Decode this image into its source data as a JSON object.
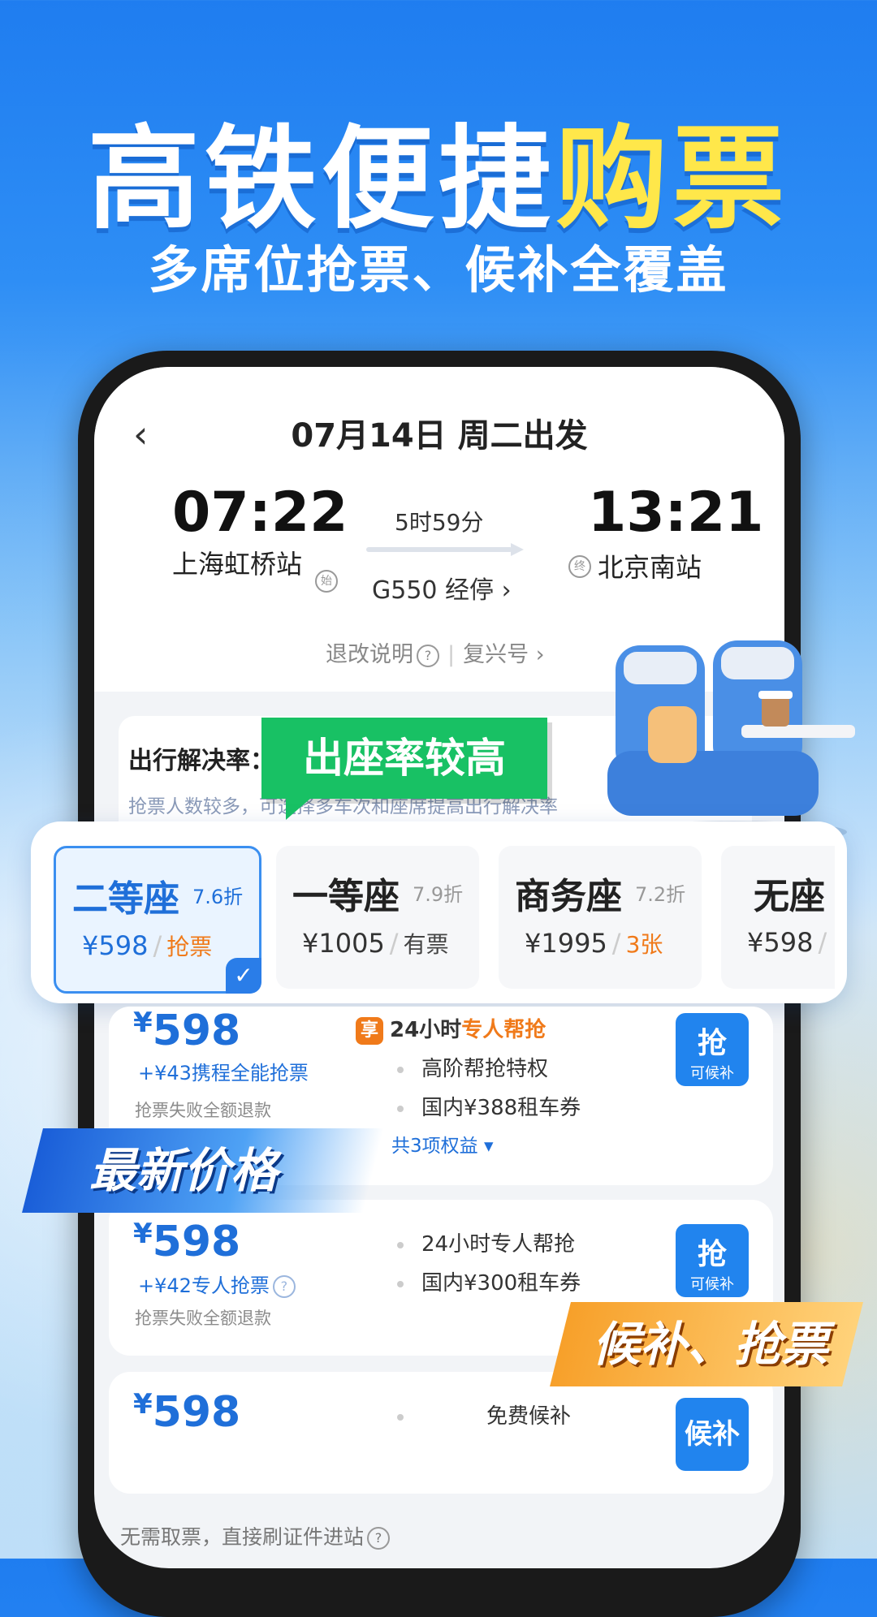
{
  "hero": {
    "title_part1": "高铁便捷",
    "title_part2": "购票",
    "subtitle": "多席位抢票、候补全覆盖"
  },
  "header": {
    "back_icon": "chevron-left-icon",
    "date": "07月14日 周二出发"
  },
  "trip": {
    "dep_time": "07:22",
    "dep_station": "上海虹桥站",
    "dep_badge": "始",
    "duration": "5时59分",
    "train": "G550 经停 ›",
    "arr_time": "13:21",
    "arr_station": "北京南站",
    "arr_badge": "终",
    "refund_link": "退改说明",
    "train_type_link": "复兴号 ›"
  },
  "solve": {
    "label": "出行解决率：",
    "note": "抢票人数较多，可选择多车次和座席提高出行解决率"
  },
  "tip_bubble": "出座率较高",
  "seats": [
    {
      "name": "二等座",
      "discount": "7.6折",
      "price": "¥598",
      "status": "抢票",
      "status_color": "#f07a1a",
      "selected": true
    },
    {
      "name": "一等座",
      "discount": "7.9折",
      "price": "¥1005",
      "status": "有票",
      "status_color": "#444444",
      "selected": false
    },
    {
      "name": "商务座",
      "discount": "7.2折",
      "price": "¥1995",
      "status": "3张",
      "status_color": "#f07a1a",
      "selected": false
    },
    {
      "name": "无座",
      "discount": "",
      "price": "¥598",
      "status": "",
      "status_color": "#444444",
      "selected": false
    }
  ],
  "options": [
    {
      "currency": "¥",
      "price": "598",
      "addon": "+¥43携程全能抢票",
      "refund": "抢票失败全额退款",
      "badge": "享",
      "benefit_head_a": "24小时",
      "benefit_head_b": "专人帮抢",
      "benefits": [
        "高阶帮抢特权",
        "国内¥388租车券"
      ],
      "more": "共3项权益 ▾",
      "button_main": "抢",
      "button_sub": "可候补"
    },
    {
      "currency": "¥",
      "price": "598",
      "addon": "+¥42专人抢票",
      "refund": "抢票失败全额退款",
      "benefits": [
        "24小时专人帮抢",
        "国内¥300租车券"
      ],
      "button_main": "抢",
      "button_sub": "可候补"
    },
    {
      "currency": "¥",
      "price": "598",
      "benefits": [
        "免费候补"
      ],
      "button_main": "候补"
    }
  ],
  "ribbons": {
    "latest_price": "最新价格",
    "waitlist_grab": "候补、抢票"
  },
  "footer_note": "无需取票，直接刷证件进站",
  "colors": {
    "accent_blue": "#1f6fd9",
    "accent_orange": "#f07a1a",
    "tip_green": "#18c164",
    "title_yellow": "#ffe74a"
  }
}
